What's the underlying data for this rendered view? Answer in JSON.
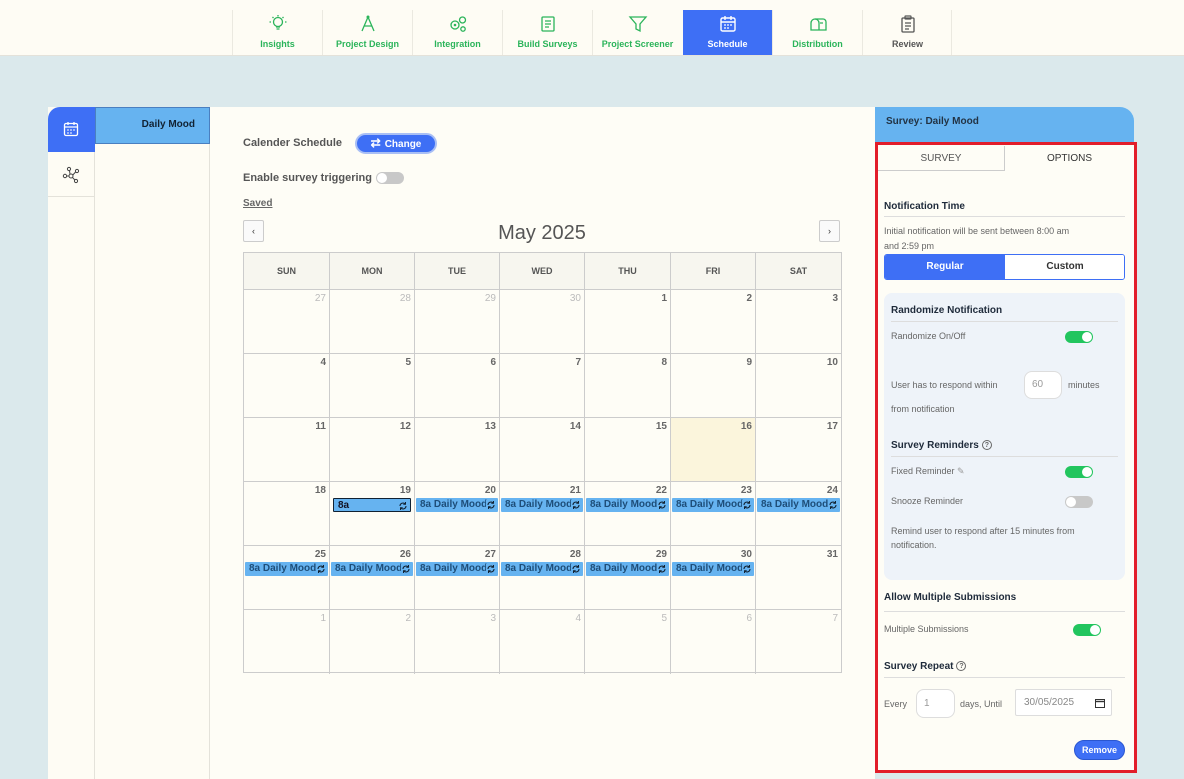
{
  "nav": {
    "items": [
      {
        "label": "Insights",
        "icon": "lightbulb-icon"
      },
      {
        "label": "Project Design",
        "icon": "compass-icon"
      },
      {
        "label": "Integration",
        "icon": "gears-icon"
      },
      {
        "label": "Build Surveys",
        "icon": "document-icon"
      },
      {
        "label": "Project Screener",
        "icon": "funnel-icon"
      },
      {
        "label": "Schedule",
        "icon": "calendar-icon"
      },
      {
        "label": "Distribution",
        "icon": "mailbox-icon"
      },
      {
        "label": "Review",
        "icon": "clipboard-icon"
      }
    ],
    "active": "Schedule"
  },
  "survey_list": {
    "items": [
      "Daily Mood"
    ]
  },
  "schedule": {
    "calendar_label": "Calender Schedule",
    "change_label": "Change",
    "triggering_label": "Enable survey triggering",
    "triggering_enabled": false,
    "saved_label": "Saved",
    "prev": "‹",
    "next": "›"
  },
  "calendar": {
    "month_title": "May 2025",
    "weekdays": [
      "SUN",
      "MON",
      "TUE",
      "WED",
      "THU",
      "FRI",
      "SAT"
    ],
    "weeks": [
      [
        27,
        28,
        29,
        30,
        1,
        2,
        3
      ],
      [
        4,
        5,
        6,
        7,
        8,
        9,
        10
      ],
      [
        11,
        12,
        13,
        14,
        15,
        16,
        17
      ],
      [
        18,
        19,
        20,
        21,
        22,
        23,
        24
      ],
      [
        25,
        26,
        27,
        28,
        29,
        30,
        31
      ],
      [
        1,
        2,
        3,
        4,
        5,
        6,
        7
      ]
    ],
    "today": 16,
    "events": {
      "w3d1": "8a",
      "w3d2": "8a Daily Mood",
      "w3d3": "8a Daily Mood",
      "w3d4": "8a Daily Mood",
      "w3d5": "8a Daily Mood",
      "w3d6": "8a Daily Mood",
      "w4d0": "8a Daily Mood",
      "w4d1": "8a Daily Mood",
      "w4d2": "8a Daily Mood",
      "w4d3": "8a Daily Mood",
      "w4d4": "8a Daily Mood",
      "w4d5": "8a Daily Mood"
    }
  },
  "panel": {
    "header": "Survey: Daily Mood",
    "tabs": {
      "survey": "SURVEY",
      "options": "OPTIONS"
    },
    "notification_time_title": "Notification Time",
    "notification_time_text_1": "Initial notification will be sent between 8:00 am",
    "notification_time_text_2": "and 2:59 pm",
    "regular_label": "Regular",
    "custom_label": "Custom",
    "randomize_title": "Randomize Notification",
    "randomize_label": "Randomize On/Off",
    "randomize_on": true,
    "respond_prefix": "User has to respond within",
    "respond_value": "60",
    "respond_suffix": "minutes",
    "respond_suffix_2": "from notification",
    "reminders_title": "Survey Reminders",
    "fixed_reminder_label": "Fixed Reminder",
    "fixed_reminder_on": true,
    "snooze_reminder_label": "Snooze Reminder",
    "snooze_reminder_on": false,
    "remind_text_1": "Remind user to respond after 15 minutes from",
    "remind_text_2": "notification.",
    "multi_title": "Allow Multiple Submissions",
    "multi_label": "Multiple Submissions",
    "multi_on": true,
    "repeat_title": "Survey Repeat",
    "every_label": "Every",
    "every_value": "1",
    "until_label": "days, Until",
    "until_value": "30/05/2025",
    "remove_label": "Remove"
  },
  "colors": {
    "accent": "#3e6ff5",
    "nav_green": "#2bb45a",
    "event_blue": "#66b3f0",
    "highlight_red": "#e21d2a",
    "toggle_on": "#22c55e"
  }
}
